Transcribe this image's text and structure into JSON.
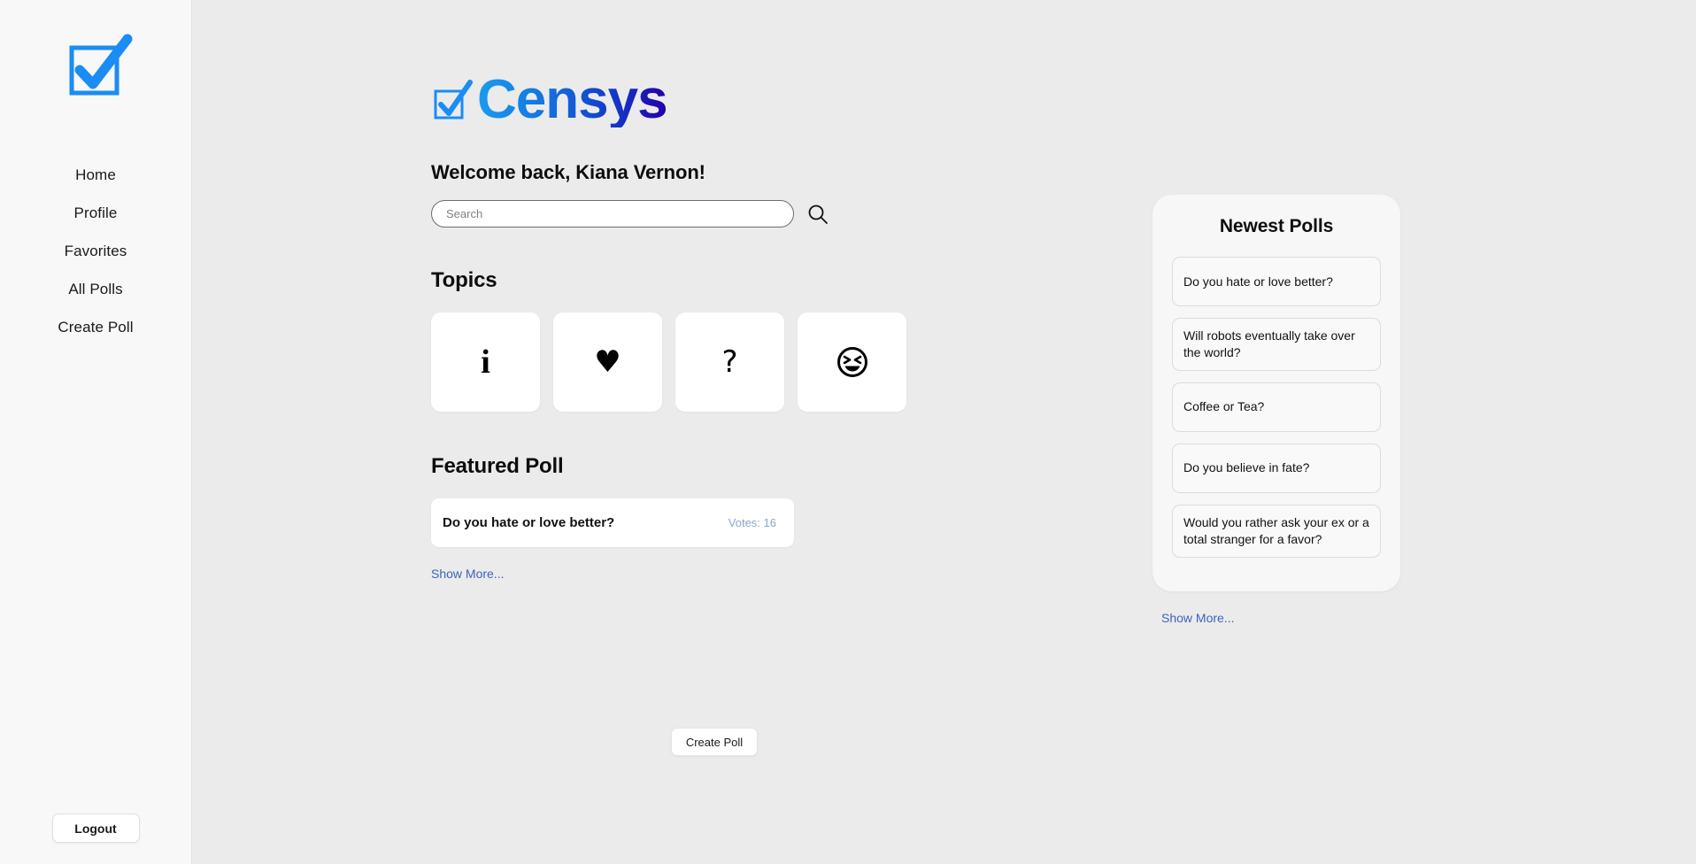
{
  "brand": {
    "name": "Censys",
    "logo_icon": "checkbox-check-icon",
    "gradient_start": "#1a9bf0",
    "gradient_end": "#2200a8"
  },
  "sidebar": {
    "logo_icon": "checkbox-check-icon",
    "items": [
      {
        "label": "Home",
        "name": "home"
      },
      {
        "label": "Profile",
        "name": "profile"
      },
      {
        "label": "Favorites",
        "name": "favorites"
      },
      {
        "label": "All Polls",
        "name": "all-polls"
      },
      {
        "label": "Create Poll",
        "name": "create-poll"
      }
    ],
    "logout_label": "Logout"
  },
  "main": {
    "welcome": "Welcome back, Kiana Vernon!",
    "search": {
      "placeholder": "Search",
      "value": "",
      "icon": "search-icon"
    },
    "topics": {
      "title": "Topics",
      "cards": [
        {
          "icon": "info-icon",
          "glyph": "i"
        },
        {
          "icon": "heart-icon",
          "glyph": "♥"
        },
        {
          "icon": "question-mark-icon",
          "glyph": "?"
        },
        {
          "icon": "laughing-face-icon",
          "glyph": "😆"
        }
      ]
    },
    "featured": {
      "title": "Featured Poll",
      "poll": {
        "question": "Do you hate or love better?",
        "votes_label": "Votes: 16",
        "votes": 16
      },
      "show_more_label": "Show More...",
      "votes_color": "#8ea4d2",
      "link_color": "#3a63c0"
    },
    "create_poll_label": "Create Poll"
  },
  "newest_polls": {
    "title": "Newest Polls",
    "items": [
      {
        "question": "Do you hate or love better?"
      },
      {
        "question": "Will robots eventually take over the world?"
      },
      {
        "question": "Coffee or Tea?"
      },
      {
        "question": "Do you believe in fate?"
      },
      {
        "question": "Would you rather ask your ex or a total stranger for a favor?"
      }
    ],
    "show_more_label": "Show More..."
  }
}
